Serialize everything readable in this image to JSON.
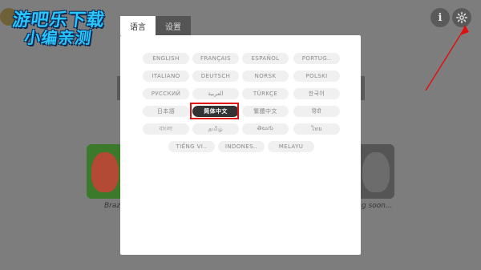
{
  "watermark": {
    "line1": "游吧乐下载",
    "line2": "小编亲测"
  },
  "top_buttons": {
    "info_glyph": "i",
    "settings_icon": "gear-icon"
  },
  "tabs": [
    {
      "label": "语言",
      "active": true
    },
    {
      "label": "设置",
      "active": false
    }
  ],
  "languages": [
    {
      "label": "ENGLISH",
      "selected": false
    },
    {
      "label": "FRANÇAIS",
      "selected": false
    },
    {
      "label": "ESPAÑOL",
      "selected": false
    },
    {
      "label": "PORTUG..",
      "selected": false
    },
    {
      "label": "ITALIANO",
      "selected": false
    },
    {
      "label": "DEUTSCH",
      "selected": false
    },
    {
      "label": "NORSK",
      "selected": false
    },
    {
      "label": "POLSKI",
      "selected": false
    },
    {
      "label": "РУССКИЙ",
      "selected": false
    },
    {
      "label": "العربية",
      "selected": false
    },
    {
      "label": "TÜRKÇE",
      "selected": false
    },
    {
      "label": "한국어",
      "selected": false
    },
    {
      "label": "日本語",
      "selected": false
    },
    {
      "label": "简体中文",
      "selected": true
    },
    {
      "label": "繁體中文",
      "selected": false
    },
    {
      "label": "हिंदी",
      "selected": false
    },
    {
      "label": "বাংলা",
      "selected": false
    },
    {
      "label": "தமிழ்",
      "selected": false
    },
    {
      "label": "తెలుగు",
      "selected": false
    },
    {
      "label": "ไทย",
      "selected": false
    },
    {
      "label": "TIẾNG VI..",
      "selected": false
    },
    {
      "label": "INDONES..",
      "selected": false
    },
    {
      "label": "MELAYU",
      "selected": false
    }
  ],
  "background_cards": {
    "left_caption": "Braz",
    "right_caption": "ming soon..."
  },
  "colors": {
    "overlay_bg": "#7d7d7d",
    "dialog_bg": "#ffffff",
    "selected_lang_bg": "#333333",
    "highlight_border": "#e01010",
    "arrow": "#e01010"
  }
}
